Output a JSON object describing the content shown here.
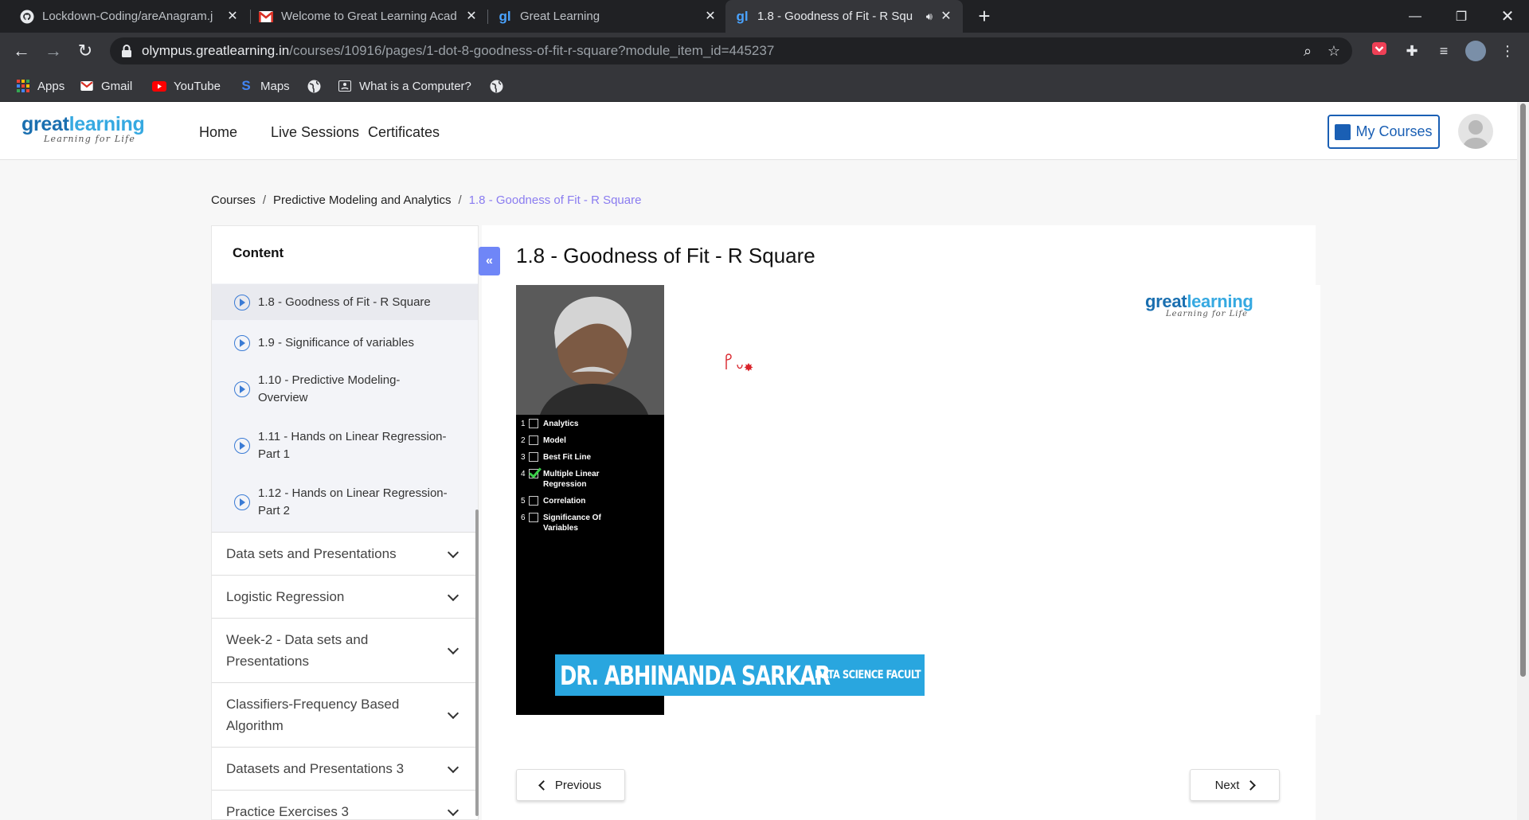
{
  "browser": {
    "tabs": [
      {
        "title": "Lockdown-Coding/areAnagram.j",
        "icon": "github-icon",
        "active": false
      },
      {
        "title": "Welcome to Great Learning Acad",
        "icon": "gmail-icon",
        "active": false
      },
      {
        "title": "Great Learning",
        "icon": "greatlearning-icon",
        "active": false
      },
      {
        "title": "1.8 - Goodness of Fit - R Squ",
        "icon": "greatlearning-icon",
        "active": true
      }
    ],
    "url_host": "olympus.greatlearning.in",
    "url_path": "/courses/10916/pages/1-dot-8-goodness-of-fit-r-square?module_item_id=445237",
    "bookmarks": [
      {
        "label": "Apps",
        "icon": "apps-grid-icon"
      },
      {
        "label": "Gmail",
        "icon": "gmail-icon"
      },
      {
        "label": "YouTube",
        "icon": "youtube-icon"
      },
      {
        "label": "Maps",
        "icon": "maps-icon"
      },
      {
        "label": "",
        "icon": "globe-icon"
      },
      {
        "label": "What is a Computer?",
        "icon": "page-icon"
      },
      {
        "label": "",
        "icon": "globe-icon"
      }
    ]
  },
  "header": {
    "logo_word_1": "great",
    "logo_word_2": "learning",
    "logo_tagline": "Learning for Life",
    "nav": [
      "Home",
      "Live Sessions",
      "Certificates"
    ],
    "my_courses": "My Courses"
  },
  "breadcrumb": {
    "items": [
      "Courses",
      "Predictive Modeling and Analytics"
    ],
    "current": "1.8 - Goodness of Fit - R Square"
  },
  "sidebar": {
    "title": "Content",
    "lessons": [
      {
        "label": "1.8 - Goodness of Fit - R Square",
        "active": true
      },
      {
        "label": "1.9 - Significance of variables",
        "active": false
      },
      {
        "label": "1.10 - Predictive Modeling-Overview",
        "active": false
      },
      {
        "label": "1.11 - Hands on Linear Regression-Part 1",
        "active": false
      },
      {
        "label": "1.12 - Hands on Linear Regression-Part 2",
        "active": false
      }
    ],
    "modules": [
      "Data sets and Presentations",
      "Logistic Regression",
      "Week-2 - Data sets and Presentations",
      "Classifiers-Frequency Based Algorithm",
      "Datasets and Presentations 3",
      "Practice Exercises 3"
    ]
  },
  "main": {
    "title": "1.8 - Goodness of Fit - R Square",
    "video": {
      "agenda": [
        {
          "num": "1",
          "text": "Analytics",
          "checked": false
        },
        {
          "num": "2",
          "text": "Model",
          "checked": false
        },
        {
          "num": "3",
          "text": "Best Fit Line",
          "checked": false
        },
        {
          "num": "4",
          "text": "Multiple Linear Regression",
          "checked": true
        },
        {
          "num": "5",
          "text": "Correlation",
          "checked": false
        },
        {
          "num": "6",
          "text": "Significance Of Variables",
          "checked": false
        }
      ],
      "presenter_name": "DR. ABHINANDA SARKAR",
      "presenter_role": "DATA SCIENCE FACULT",
      "logo_word_1": "great",
      "logo_word_2": "learning",
      "logo_tagline": "Learning for Life"
    },
    "previous_label": "Previous",
    "next_label": "Next"
  }
}
